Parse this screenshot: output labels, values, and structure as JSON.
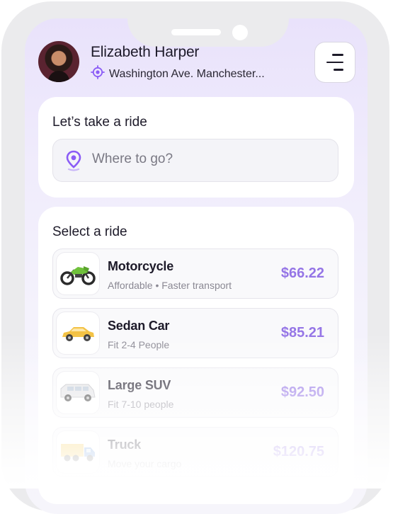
{
  "user": {
    "name": "Elizabeth Harper",
    "location": "Washington Ave. Manchester..."
  },
  "search_card": {
    "title": "Let’s take a ride",
    "search_placeholder": "Where to go?"
  },
  "rides_card": {
    "title": "Select a ride",
    "rides": [
      {
        "name": "Motorcycle",
        "desc": "Affordable • Faster transport",
        "price": "$66.22",
        "icon": "motorcycle-icon"
      },
      {
        "name": "Sedan Car",
        "desc": "Fit 2-4 People",
        "price": "$85.21",
        "icon": "sedan-car-icon"
      },
      {
        "name": "Large SUV",
        "desc": "Fit 7-10 people",
        "price": "$92.50",
        "icon": "suv-icon"
      },
      {
        "name": "Truck",
        "desc": "Move your cargo",
        "price": "$120.75",
        "icon": "truck-icon"
      }
    ]
  },
  "colors": {
    "accent": "#9575e6",
    "pin": "#8b5cf6",
    "text": "#1d1a29",
    "muted": "#8a8893"
  }
}
